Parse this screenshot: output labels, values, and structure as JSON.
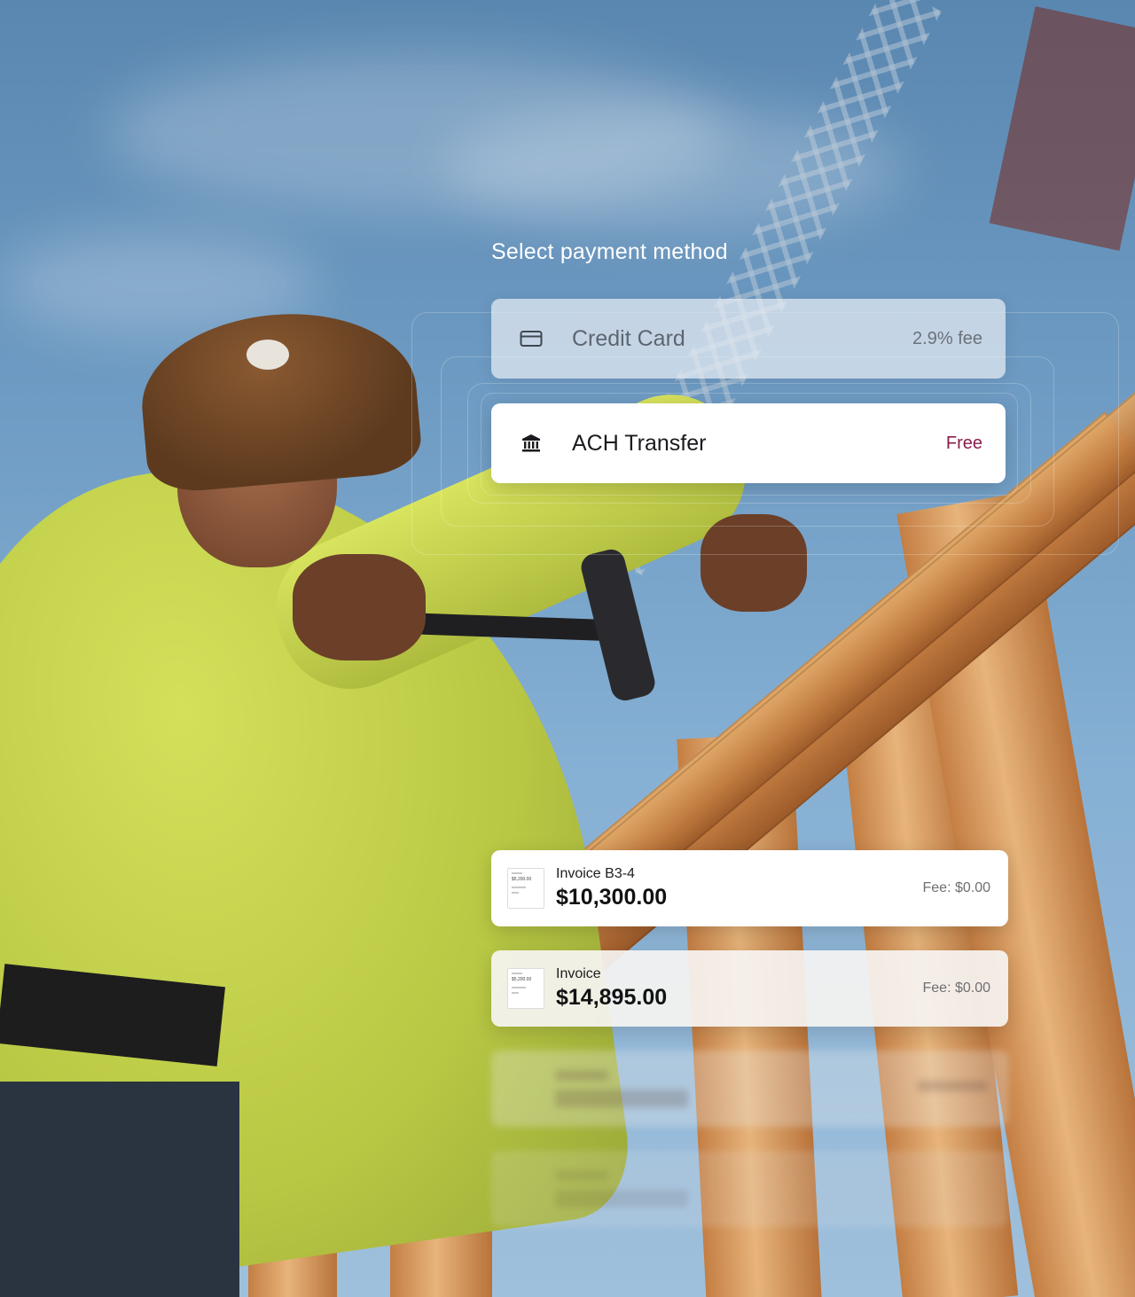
{
  "title": "Select payment method",
  "payment_methods": [
    {
      "label": "Credit Card",
      "fee": "2.9% fee",
      "icon": "credit-card-icon",
      "selected": false
    },
    {
      "label": "ACH Transfer",
      "fee": "Free",
      "icon": "bank-icon",
      "selected": true
    }
  ],
  "invoices": [
    {
      "name": "Invoice B3-4",
      "amount": "$10,300.00",
      "fee": "Fee: $0.00",
      "thumb_text": "$5,200.00"
    },
    {
      "name": "Invoice",
      "amount": "$14,895.00",
      "fee": "Fee: $0.00",
      "thumb_text": "$5,200.00"
    }
  ],
  "colors": {
    "accent_free": "#8a1d4c",
    "sky": "#6e9bc3",
    "shirt": "#c5d34d",
    "wood": "#d9a064"
  }
}
